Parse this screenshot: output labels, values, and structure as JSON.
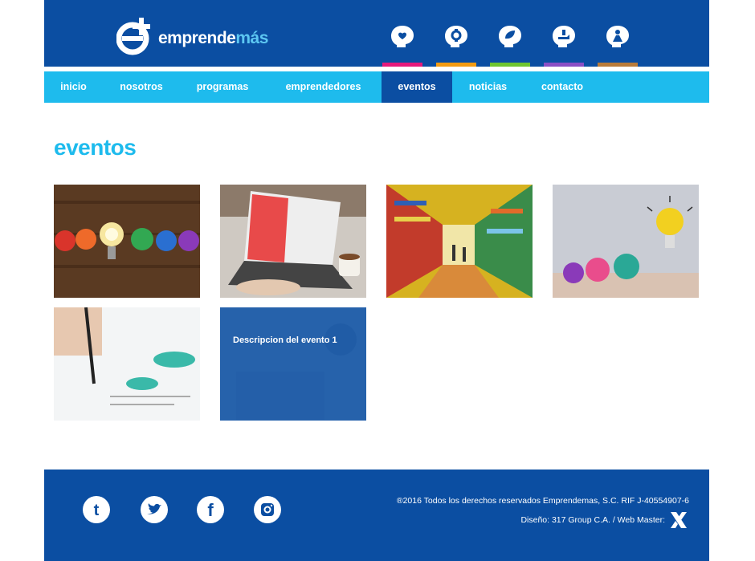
{
  "header": {
    "logo_text_main": "emprende",
    "logo_text_accent": "más",
    "category_icons": [
      {
        "name": "heart-head-icon",
        "color": "#e5197c"
      },
      {
        "name": "gear-head-icon",
        "color": "#f39b12"
      },
      {
        "name": "leaf-head-icon",
        "color": "#6ec530"
      },
      {
        "name": "hand-head-icon",
        "color": "#8a4ec5"
      },
      {
        "name": "person-head-icon",
        "color": "#b87b3a"
      }
    ]
  },
  "nav": {
    "items": [
      {
        "label": "inicio"
      },
      {
        "label": "nosotros"
      },
      {
        "label": "programas"
      },
      {
        "label": "emprendedores"
      },
      {
        "label": "eventos"
      },
      {
        "label": "noticias"
      },
      {
        "label": "contacto"
      }
    ],
    "active": "eventos"
  },
  "page": {
    "title": "eventos"
  },
  "events": {
    "tiles": [
      {
        "image": "crumpled-paper-lightbulb-photo"
      },
      {
        "image": "laptop-coffee-photo"
      },
      {
        "image": "bookstore-photo"
      },
      {
        "image": "yellow-paper-bulb-photo"
      },
      {
        "image": "hand-writing-chart-photo"
      },
      {
        "image": "desk-overlay-photo",
        "overlay_text": "Descripcion del evento 1"
      }
    ]
  },
  "footer": {
    "social": [
      {
        "name": "tumblr-icon",
        "glyph": "t"
      },
      {
        "name": "twitter-icon"
      },
      {
        "name": "facebook-icon",
        "glyph": "f"
      },
      {
        "name": "instagram-icon"
      }
    ],
    "copyright": "®2016 Todos los derechos reservados Emprendemas, S.C. RIF J-40554907-6",
    "credit": "Diseño: 317 Group C.A. / Web Master:"
  },
  "colors": {
    "brand_blue": "#0b4ea2",
    "nav_cyan": "#1ebbed"
  }
}
